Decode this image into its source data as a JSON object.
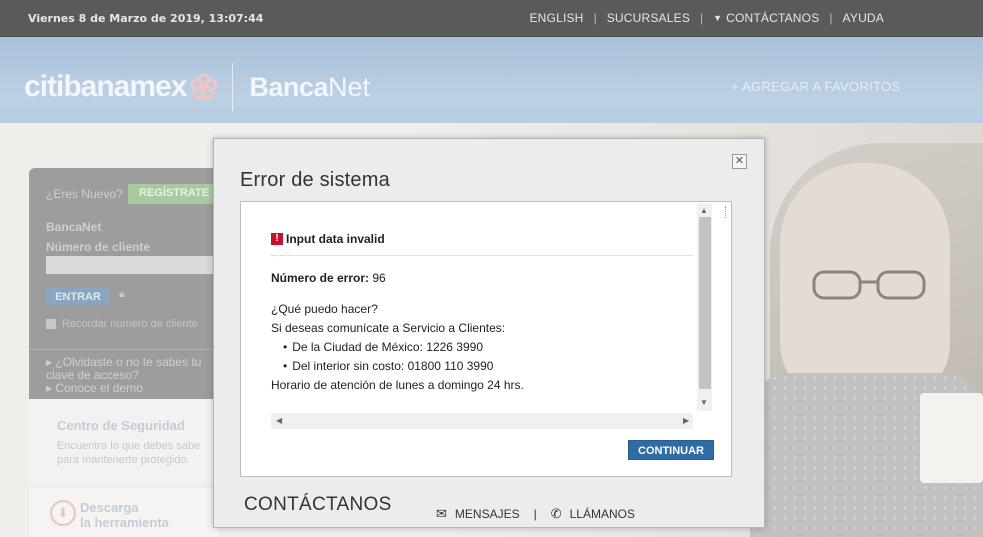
{
  "topbar": {
    "date": "Viernes 8 de Marzo de 2019, 13:07:44",
    "links": [
      "ENGLISH",
      "SUCURSALES",
      "CONTÁCTANOS",
      "AYUDA"
    ]
  },
  "header": {
    "logo_citi": "citibanamex",
    "logo_banca": "Banca",
    "logo_net": "Net",
    "favorites": "+ AGREGAR A FAVORITOS"
  },
  "login": {
    "new_q": "¿Eres Nuevo?",
    "register": "REGÍSTRATE",
    "product": "BancaNet",
    "client_label": "Número de cliente",
    "enter": "ENTRAR",
    "remember": "Recordar número de cliente",
    "forgot_1": "¿Olvidaste o no te sabes tu",
    "forgot_2": "clave de acceso?",
    "demo": "Conoce el demo"
  },
  "security": {
    "title": "Centro de Seguridad",
    "desc_1": "Encuentra lo que debes sabe",
    "desc_2": "para mantenerte protegido."
  },
  "download": {
    "title_1": "Descarga",
    "title_2": "la herramienta"
  },
  "modal": {
    "title": "Error de sistema",
    "error_heading": "Input data invalid",
    "error_number_label": "Número de error:",
    "error_number": "96",
    "help_q": "¿Qué puedo hacer?",
    "help_intro": "Si deseas comunícate a Servicio a Clientes:",
    "help_city": "De la Ciudad de México: 1226 3990",
    "help_interior": "Del interior sin costo: 01800 110 3990",
    "help_hours": "Horario de atención de lunes a domingo 24 hrs.",
    "continue": "CONTINUAR",
    "contact_title": "CONTÁCTANOS",
    "messages": "MENSAJES",
    "call": "LLÁMANOS"
  },
  "colors": {
    "topbar": "#5a5a5a",
    "header": "#b7cde2",
    "error_red": "#c8102e",
    "button_blue": "#2f6ca6"
  }
}
